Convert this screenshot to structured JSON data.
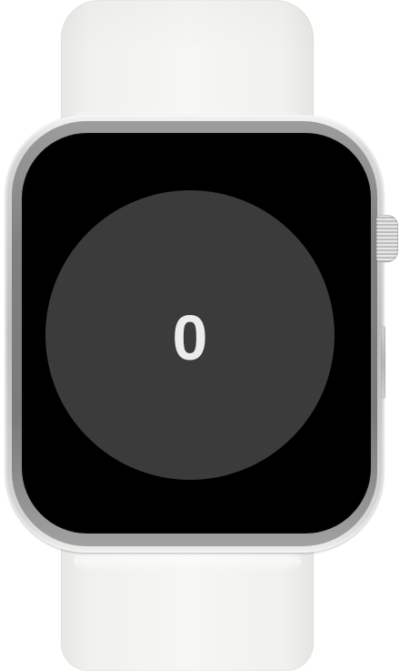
{
  "device": {
    "type": "smartwatch",
    "colors": {
      "band": "#f2f2f0",
      "case": "#c2c2c2",
      "screen_background": "#000000",
      "button_fill": "#3b3b3b",
      "text": "#ececec"
    }
  },
  "counter": {
    "value": "0"
  }
}
